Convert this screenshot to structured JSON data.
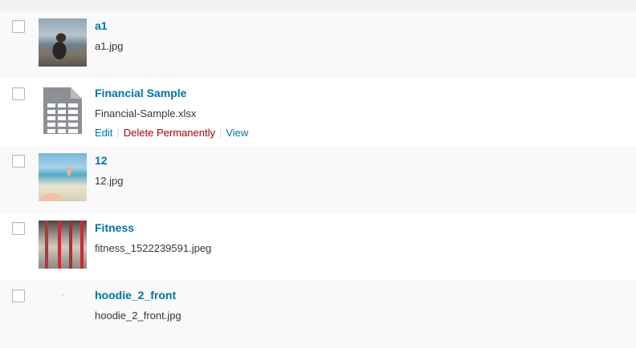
{
  "media_items": [
    {
      "title": "a1",
      "filename": "a1.jpg",
      "thumbnail": "photo-woman-sitting-outdoors"
    },
    {
      "title": "Financial Sample",
      "filename": "Financial-Sample.xlsx",
      "thumbnail": "spreadsheet-document-icon",
      "row_actions": {
        "edit": "Edit",
        "delete": "Delete Permanently",
        "view": "View",
        "separator": "|"
      }
    },
    {
      "title": "12",
      "filename": "12.jpg",
      "thumbnail": "photo-beach"
    },
    {
      "title": "Fitness",
      "filename": "fitness_1522239591.jpeg",
      "thumbnail": "photo-fitness-class"
    },
    {
      "title": "hoodie_2_front",
      "filename": "hoodie_2_front.jpg",
      "thumbnail": "photo-blank"
    }
  ],
  "colors": {
    "link": "#0073aa",
    "delete": "#aa0000",
    "row_alt": "#f9f9f9",
    "row": "#ffffff"
  }
}
